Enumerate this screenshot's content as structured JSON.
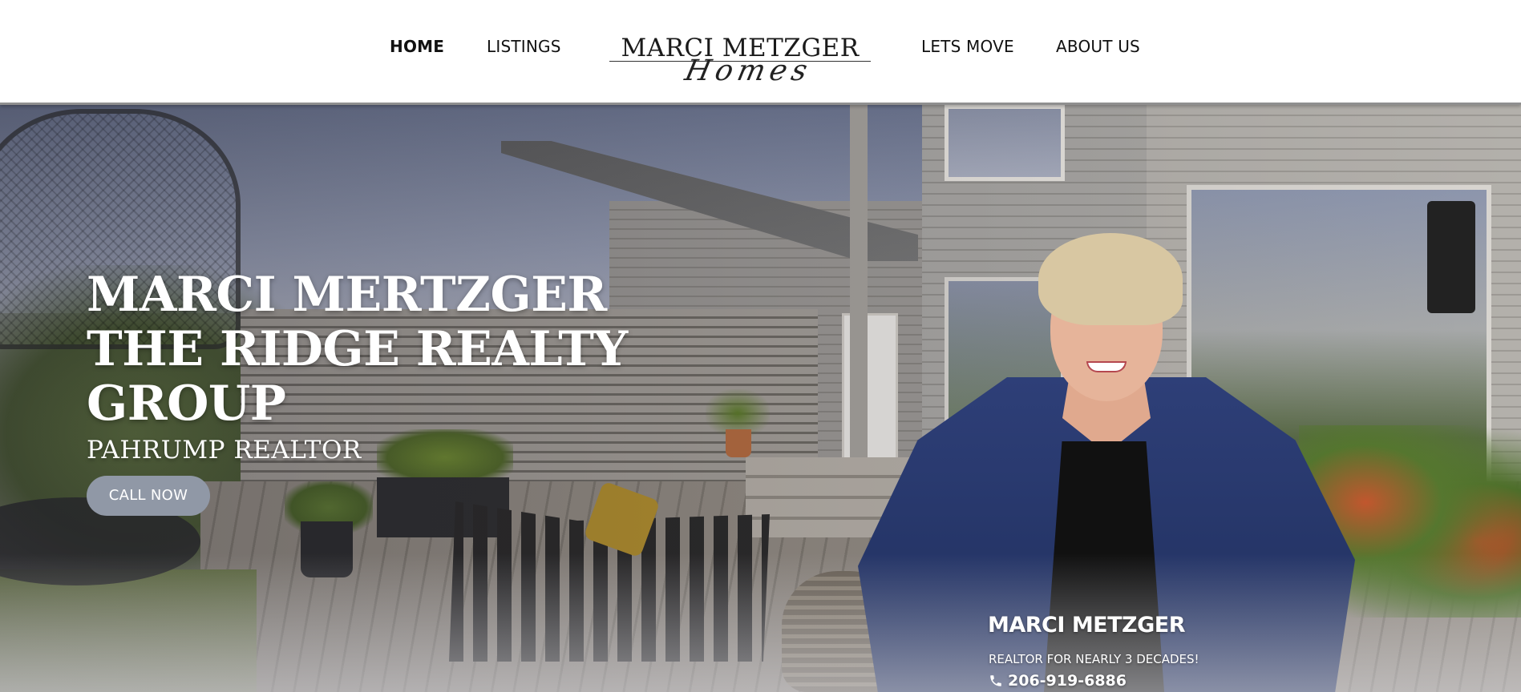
{
  "nav": {
    "home": "HOME",
    "listings": "LISTINGS",
    "lets_move": "LETS MOVE",
    "about_us": "ABOUT US",
    "active": "HOME"
  },
  "logo": {
    "main": "MARCI METZGER",
    "script": "Homes"
  },
  "hero": {
    "title_lines": [
      "MARCI MERTZGER",
      "THE RIDGE REALTY",
      "GROUP"
    ],
    "subtitle": "PAHRUMP REALTOR",
    "cta_label": "CALL NOW",
    "cta_color": "#9098a6"
  },
  "agent": {
    "name": "MARCI METZGER",
    "tagline": "REALTOR FOR NEARLY 3 DECADES!",
    "phone": "206-919-6886",
    "phone_icon": "phone-icon"
  }
}
